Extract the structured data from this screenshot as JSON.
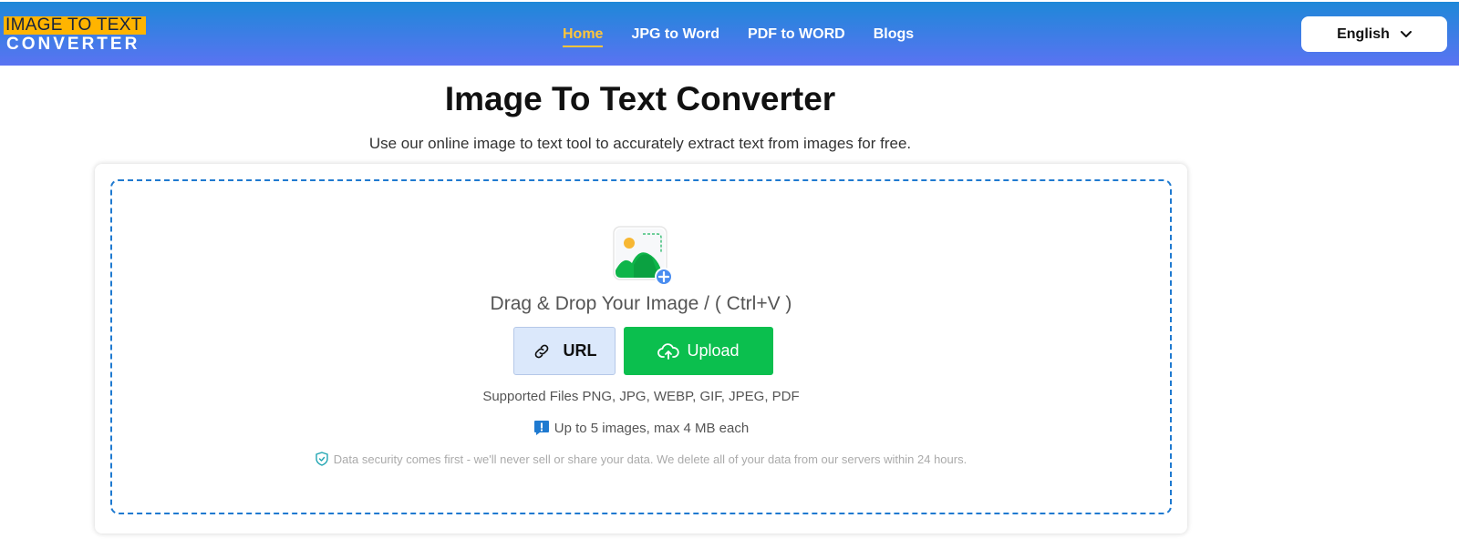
{
  "header": {
    "logo_top": "IMAGE TO TEXT",
    "logo_bottom": "CONVERTER",
    "nav": [
      {
        "label": "Home",
        "active": true
      },
      {
        "label": "JPG to Word"
      },
      {
        "label": "PDF to WORD"
      },
      {
        "label": "Blogs"
      }
    ],
    "language": "English"
  },
  "main": {
    "title": "Image To Text Converter",
    "subtitle": "Use our online image to text tool to accurately extract text from images for free.",
    "drop_text": "Drag & Drop Your Image / ( Ctrl+V )",
    "url_button": "URL",
    "upload_button": "Upload",
    "supported": "Supported Files PNG, JPG, WEBP, GIF, JPEG, PDF",
    "limit": "Up to 5 images, max 4 MB each",
    "security": "Data security comes first - we'll never sell or share your data. We delete all of your data from our servers within 24 hours."
  },
  "colors": {
    "header_top": "#1e88d8",
    "header_bottom": "#5a73f2",
    "logo_accent": "#ffb400",
    "active_nav": "#ffc53a",
    "upload_button": "#0bbf4e",
    "url_button": "#dbe8fb",
    "dropzone_border": "#1f7ad0"
  },
  "icons": [
    "link-icon",
    "cloud-upload-icon",
    "image-add-icon",
    "info-alert-icon",
    "shield-check-icon",
    "chevron-down-icon"
  ]
}
